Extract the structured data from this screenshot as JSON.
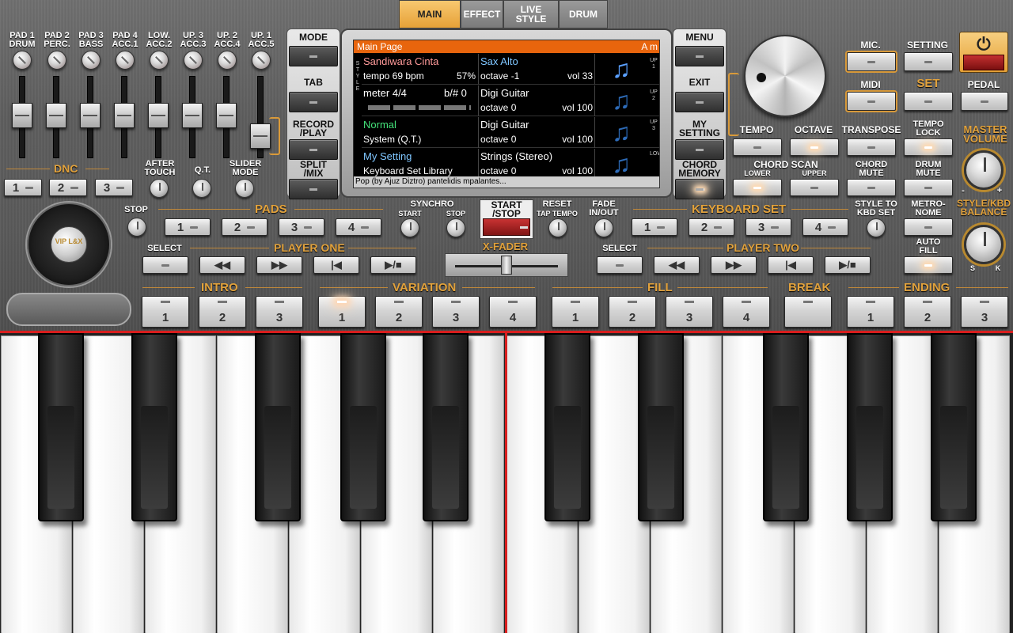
{
  "tabs": [
    {
      "label": "MAIN",
      "active": true
    },
    {
      "label": "EFFECT",
      "active": false
    },
    {
      "label": "LIVE\nSTYLE",
      "active": false
    },
    {
      "label": "DRUM",
      "active": false
    }
  ],
  "pads_mixer": [
    "PAD 1\nDRUM",
    "PAD 2\nPERC.",
    "PAD 3\nBASS",
    "PAD 4\nACC.1",
    "LOW.\nACC.2",
    "UP. 3\nACC.3",
    "UP. 2\nACC.4",
    "UP. 1\nACC.5"
  ],
  "dnc": {
    "label": "DNC",
    "buttons": [
      "1",
      "2",
      "3"
    ],
    "after_touch": "AFTER\nTOUCH",
    "qt": "Q.T.",
    "slider_mode": "SLIDER\nMODE"
  },
  "left_side": {
    "mode": "MODE",
    "tab": "TAB",
    "record": "RECORD\n/PLAY",
    "split": "SPLIT\n/MIX"
  },
  "right_side": {
    "menu": "MENU",
    "exit": "EXIT",
    "my_setting": "MY\nSETTING",
    "chord_memory": "CHORD\nMEMORY"
  },
  "lcd": {
    "title": "Main Page",
    "chord": "A m",
    "style_name": "Sandiwara Cinta",
    "tempo": "tempo 69 bpm",
    "percent": "57%",
    "meter": "meter 4/4",
    "key": "b/# 0",
    "sys_name": "Normal",
    "sys_sub": "System (Q.T.)",
    "kbd_name": "My Setting",
    "kbd_sub": "Keyboard Set Library",
    "parts": [
      {
        "name": "Sax Alto",
        "octave": "octave -1",
        "vol": "vol 33"
      },
      {
        "name": "Digi Guitar",
        "octave": "octave  0",
        "vol": "vol 100"
      },
      {
        "name": "Digi Guitar",
        "octave": "octave  0",
        "vol": "vol 100"
      },
      {
        "name": "Strings (Stereo)",
        "octave": "octave  0",
        "vol": "vol 100"
      }
    ],
    "footer": "Pop (by Ajuz Diztro) pantelidis mpalantes...",
    "side_left": [
      "S",
      "T",
      "Y",
      "L",
      "E"
    ],
    "side_right": [
      "UP 1",
      "UP 2",
      "UP 3",
      "LOW"
    ]
  },
  "right_panel": {
    "mic": "MIC.",
    "setting": "SETTING",
    "midi": "MIDI",
    "set": "SET",
    "pedal": "PEDAL",
    "tempo": "TEMPO",
    "octave": "OCTAVE",
    "transpose": "TRANSPOSE",
    "tempo_lock": "TEMPO\nLOCK",
    "master_volume": "MASTER\nVOLUME",
    "chord_scan": "CHORD SCAN",
    "lower": "LOWER",
    "upper": "UPPER",
    "chord_mute": "CHORD\nMUTE",
    "drum_mute": "DRUM\nMUTE",
    "style_kbd_balance": "STYLE/KBD\nBALANCE",
    "vol_min": "-",
    "vol_max": "+",
    "bal_s": "S",
    "bal_k": "K"
  },
  "pads_row": {
    "stop": "STOP",
    "pads": "PADS",
    "buttons": [
      "1",
      "2",
      "3",
      "4"
    ],
    "synchro": "SYNCHRO",
    "sync_start": "START",
    "sync_stop": "STOP",
    "start_stop": "START\n/STOP",
    "reset": "RESET",
    "tap_tempo": "TAP TEMPO",
    "fade": "FADE\nIN/OUT",
    "keyboard_set": "KEYBOARD SET",
    "kbd_buttons": [
      "1",
      "2",
      "3",
      "4"
    ],
    "style_to_kbd": "STYLE TO\nKBD SET",
    "metronome": "METRO-\nNOME"
  },
  "player_row": {
    "select1": "SELECT",
    "player_one": "PLAYER ONE",
    "xfader": "X-FADER",
    "select2": "SELECT",
    "player_two": "PLAYER TWO",
    "auto_fill": "AUTO\nFILL"
  },
  "vip": "VIP\nL&X",
  "sections": {
    "intro": {
      "label": "INTRO",
      "buttons": [
        "1",
        "2",
        "3"
      ]
    },
    "variation": {
      "label": "VARIATION",
      "buttons": [
        "1",
        "2",
        "3",
        "4"
      ]
    },
    "fill": {
      "label": "FILL",
      "buttons": [
        "1",
        "2",
        "3",
        "4"
      ]
    },
    "break": {
      "label": "BREAK"
    },
    "ending": {
      "label": "ENDING",
      "buttons": [
        "1",
        "2",
        "3"
      ]
    }
  },
  "icons": {
    "power": "power-icon",
    "note": "music-note-icon",
    "rewind": "rewind-icon",
    "forward": "fast-forward-icon",
    "prev": "skip-back-icon",
    "play": "play-stop-icon"
  },
  "colors": {
    "accent": "#e2a23c",
    "lcd_bar": "#e8650d",
    "split": "#d81e1e",
    "note": "#3a86d8"
  }
}
